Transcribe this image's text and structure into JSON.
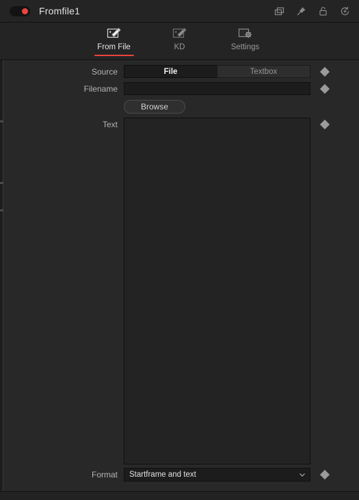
{
  "window": {
    "node_title": "Fromfile1",
    "node_enabled_color": "#e8453c",
    "accent_color": "#e8453c",
    "icons": [
      {
        "name": "duplicate-icon",
        "glyph": "duplicate"
      },
      {
        "name": "pin-icon",
        "glyph": "pin"
      },
      {
        "name": "lock-icon",
        "glyph": "lock-open"
      },
      {
        "name": "reset-icon",
        "glyph": "history-reset"
      }
    ]
  },
  "tabs": [
    {
      "label": "From File",
      "icon": "magic-wand-file-icon",
      "active": true
    },
    {
      "label": "KD",
      "icon": "magic-wand-file-icon",
      "active": false
    },
    {
      "label": "Settings",
      "icon": "screen-gear-icon",
      "active": false
    }
  ],
  "form": {
    "source": {
      "label": "Source",
      "options": [
        "File",
        "Textbox"
      ],
      "selected": "File"
    },
    "filename": {
      "label": "Filename",
      "value": "",
      "placeholder": ""
    },
    "browse": {
      "label": "Browse"
    },
    "text": {
      "label": "Text",
      "value": "",
      "placeholder": ""
    },
    "format": {
      "label": "Format",
      "value": "Startframe and text",
      "options": [
        "Startframe and text"
      ]
    }
  }
}
